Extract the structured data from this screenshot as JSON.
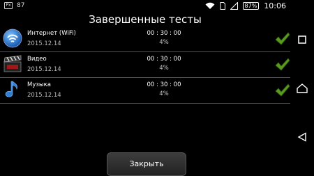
{
  "status_bar": {
    "app_icon_text": "Px",
    "left_text": "87",
    "battery": "87%",
    "time": "10:06"
  },
  "screen": {
    "title": "Завершенные тесты"
  },
  "tests": [
    {
      "name": "Интернет (WiFi)",
      "date": "2015.12.14",
      "duration": "00 : 30 : 00",
      "percent": "4%",
      "icon": "wifi-icon"
    },
    {
      "name": "Видео",
      "date": "2015.12.14",
      "duration": "00 : 30 : 00",
      "percent": "4%",
      "icon": "video-clapper-icon"
    },
    {
      "name": "Музыка",
      "date": "2015.12.14",
      "duration": "00 : 30 : 00",
      "percent": "4%",
      "icon": "music-note-icon"
    }
  ],
  "close_button": {
    "label": "Закрыть"
  },
  "navigation": [
    "recent-apps-icon",
    "home-icon",
    "back-icon"
  ],
  "colors": {
    "background": "#000000",
    "check": "#5a9a1e",
    "row_divider": "#555555"
  }
}
